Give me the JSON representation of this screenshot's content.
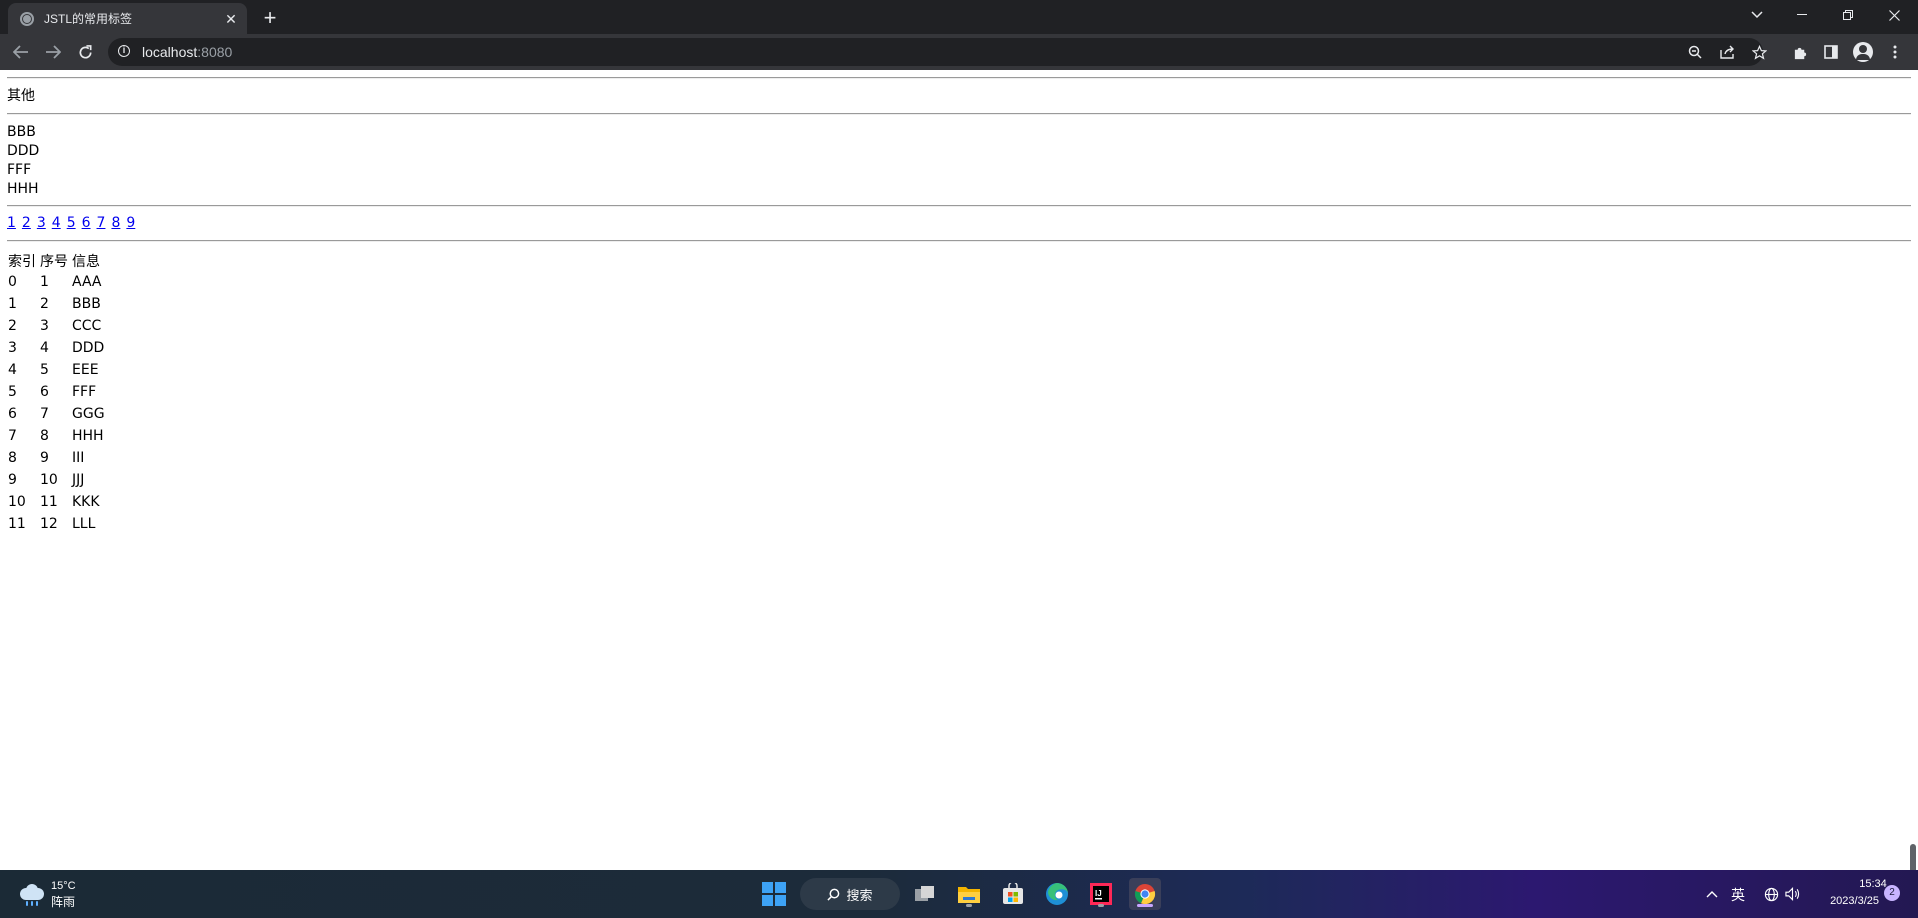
{
  "browser": {
    "tab_title": "JSTL的常用标签",
    "tab_close": "✕",
    "new_tab": "+",
    "url_host": "localhost",
    "url_port": ":8080"
  },
  "page": {
    "otherwise_text": "其他",
    "filtered_items": [
      "BBB",
      "DDD",
      "FFF",
      "HHH"
    ],
    "page_links": [
      "1",
      "2",
      "3",
      "4",
      "5",
      "6",
      "7",
      "8",
      "9"
    ],
    "table": {
      "headers": [
        "索引",
        "序号",
        "信息"
      ],
      "rows": [
        [
          "0",
          "1",
          "AAA"
        ],
        [
          "1",
          "2",
          "BBB"
        ],
        [
          "2",
          "3",
          "CCC"
        ],
        [
          "3",
          "4",
          "DDD"
        ],
        [
          "4",
          "5",
          "EEE"
        ],
        [
          "5",
          "6",
          "FFF"
        ],
        [
          "6",
          "7",
          "GGG"
        ],
        [
          "7",
          "8",
          "HHH"
        ],
        [
          "8",
          "9",
          "III"
        ],
        [
          "9",
          "10",
          "JJJ"
        ],
        [
          "10",
          "11",
          "KKK"
        ],
        [
          "11",
          "12",
          "LLL"
        ]
      ]
    }
  },
  "taskbar": {
    "weather_temp": "15°C",
    "weather_desc": "阵雨",
    "search_label": "搜索",
    "input_method": "英",
    "time": "15:34",
    "date": "2023/3/25",
    "notification_count": "2"
  },
  "icons": {
    "back": "back-arrow-icon",
    "forward": "forward-arrow-icon",
    "reload": "reload-icon",
    "zoom": "zoom-icon",
    "share": "share-icon",
    "bookmark": "star-icon",
    "extensions": "puzzle-icon",
    "side_panel": "side-panel-icon",
    "profile": "profile-icon",
    "menu": "kebab-menu-icon"
  },
  "colors": {
    "link": "#0000ee",
    "chrome_dark": "#202124",
    "chrome_toolbar": "#35363a"
  }
}
